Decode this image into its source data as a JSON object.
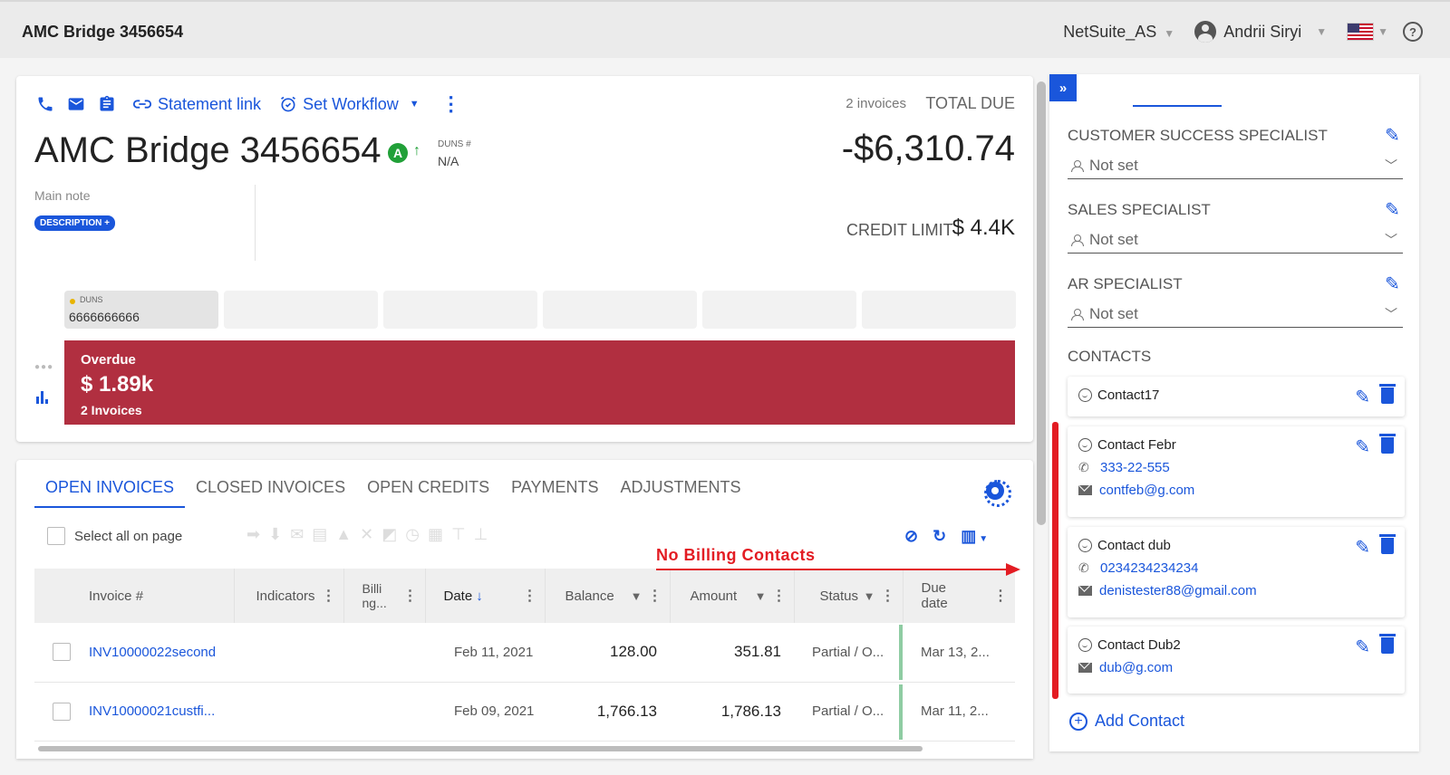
{
  "app": {
    "title": "AMC Bridge 3456654",
    "account_selector": "NetSuite_AS",
    "user_name": "Andrii Siryi",
    "help": "?"
  },
  "summary": {
    "actions": {
      "statement_link": "Statement link",
      "set_workflow": "Set Workflow"
    },
    "account_name": "AMC Bridge 3456654",
    "rating_badge": "A",
    "duns_label": "DUNS #",
    "duns_value": "N/A",
    "invoice_count": "2 invoices",
    "total_due_label": "TOTAL DUE",
    "total_due": "-$6,310.74",
    "main_note": "Main note",
    "description_button": "DESCRIPTION +",
    "credit_limit_label": "CREDIT LIMIT",
    "credit_limit_value": "$ 4.4K",
    "tiles": [
      {
        "label": "DUNS",
        "value": "6666666666"
      }
    ],
    "overdue": {
      "title": "Overdue",
      "amount": "$ 1.89k",
      "count": "2 Invoices",
      "color": "#b12f40"
    }
  },
  "invoices": {
    "tabs": [
      "OPEN INVOICES",
      "CLOSED INVOICES",
      "OPEN CREDITS",
      "PAYMENTS",
      "ADJUSTMENTS"
    ],
    "active_tab": "OPEN INVOICES",
    "select_all_label": "Select all on page",
    "columns": {
      "invoice": "Invoice #",
      "indicators": "Indicators",
      "billing": "Billi ng...",
      "date": "Date",
      "balance": "Balance",
      "amount": "Amount",
      "status": "Status",
      "due": "Due date"
    },
    "rows": [
      {
        "invoice": "INV10000022second",
        "date": "Feb 11, 2021",
        "balance": "128.00",
        "amount": "351.81",
        "status": "Partial / O...",
        "due": "Mar 13, 2..."
      },
      {
        "invoice": "INV10000021custfi...",
        "date": "Feb 09, 2021",
        "balance": "1,766.13",
        "amount": "1,786.13",
        "status": "Partial / O...",
        "due": "Mar 11, 2..."
      }
    ]
  },
  "annotation": {
    "label": "No  Billing Contacts",
    "color": "#e31c23"
  },
  "panel": {
    "roles": [
      {
        "title": "CUSTOMER SUCCESS SPECIALIST",
        "value": "Not set"
      },
      {
        "title": "SALES SPECIALIST",
        "value": "Not set"
      },
      {
        "title": "AR SPECIALIST",
        "value": "Not set"
      }
    ],
    "contacts_title": "CONTACTS",
    "contacts": [
      {
        "name": "Contact17"
      },
      {
        "name": "Contact Febr",
        "phone": "333-22-555",
        "email": "contfeb@g.com"
      },
      {
        "name": "Contact dub",
        "phone": "0234234234234",
        "email": "denistester88@gmail.com"
      },
      {
        "name": "Contact Dub2",
        "email": "dub@g.com"
      }
    ],
    "add_contact": "Add Contact"
  },
  "colors": {
    "accent": "#1a56db",
    "status_ok": "#8fcca3"
  }
}
